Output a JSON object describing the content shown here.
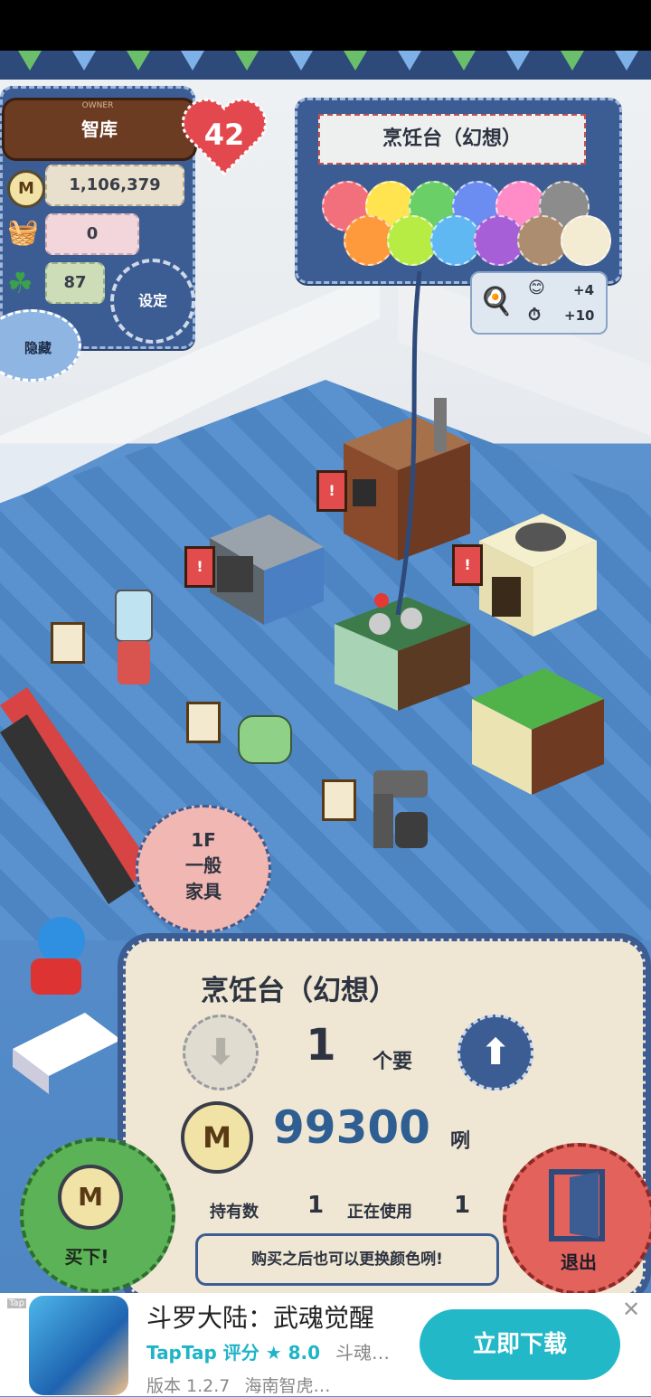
{
  "owner": {
    "label": "OWNER",
    "name": "智库",
    "level": "42"
  },
  "stats": {
    "money": "1,106,379",
    "items": "0",
    "clover": "87"
  },
  "buttons": {
    "settings": "设定",
    "hide": "隐藏",
    "buy": "买下!",
    "exit": "退出"
  },
  "color_panel": {
    "title": "烹饪台（幻想）",
    "swatches": [
      "#f2707c",
      "#ffe34f",
      "#69cf66",
      "#6b8cf0",
      "#ff8bc7",
      "#8c8c8c",
      "#ff9a3c",
      "#b7ec45",
      "#5fb8f2",
      "#a65fd6",
      "#ad8d70",
      "#f3ecd2"
    ]
  },
  "cook_bonus": {
    "smile": "+4",
    "time": "+10"
  },
  "floor": {
    "level": "1F",
    "line1": "一般",
    "line2": "家具"
  },
  "dialog": {
    "title": "烹饪台（幻想）",
    "quantity": "1",
    "quantity_unit": "个要",
    "price": "99300",
    "price_unit": "咧",
    "owned_label": "持有数",
    "owned_value": "1",
    "inuse_label": "正在使用",
    "inuse_value": "1",
    "hint": "购买之后也可以更换颜色咧!"
  },
  "ad": {
    "title": "斗罗大陆：武魂觉醒",
    "brand": "TapTap",
    "rating_label": "评分",
    "rating": "8.0",
    "short": "斗魂…",
    "version": "版本 1.2.7",
    "publisher": "海南智虎…",
    "cta": "立即下载",
    "tag": "Tap"
  },
  "colors": {
    "denim": "#3c5d94",
    "accent_red": "#e3635c",
    "accent_green": "#5cb357"
  }
}
